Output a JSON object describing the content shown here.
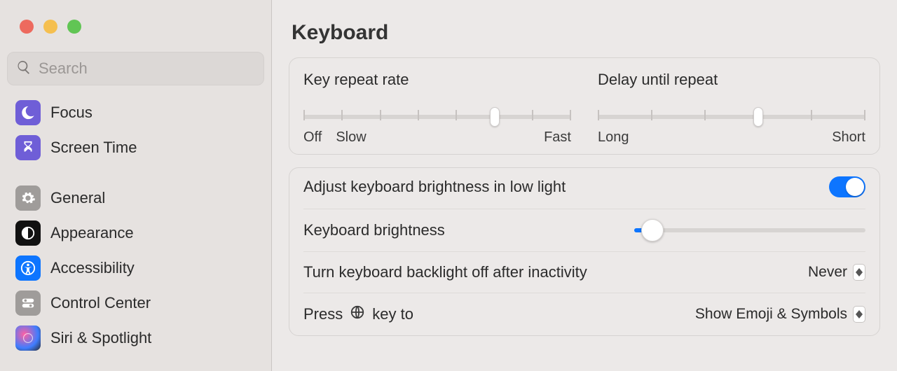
{
  "sidebar": {
    "search_placeholder": "Search",
    "items": [
      {
        "label": "Focus"
      },
      {
        "label": "Screen Time"
      },
      {
        "label": "General"
      },
      {
        "label": "Appearance"
      },
      {
        "label": "Accessibility"
      },
      {
        "label": "Control Center"
      },
      {
        "label": "Siri & Spotlight"
      }
    ]
  },
  "page": {
    "title": "Keyboard"
  },
  "key_repeat": {
    "title": "Key repeat rate",
    "labels": {
      "off": "Off",
      "slow": "Slow",
      "fast": "Fast"
    },
    "ticks": 8,
    "value_index": 5
  },
  "delay_repeat": {
    "title": "Delay until repeat",
    "labels": {
      "long": "Long",
      "short": "Short"
    },
    "ticks": 6,
    "value_index": 3
  },
  "settings": {
    "auto_brightness_label": "Adjust keyboard brightness in low light",
    "auto_brightness_on": true,
    "brightness_label": "Keyboard brightness",
    "brightness_pct": 8,
    "backlight_off_label": "Turn keyboard backlight off after inactivity",
    "backlight_off_value": "Never",
    "globe_key_prefix": "Press",
    "globe_key_suffix": "key to",
    "globe_key_value": "Show Emoji & Symbols"
  }
}
